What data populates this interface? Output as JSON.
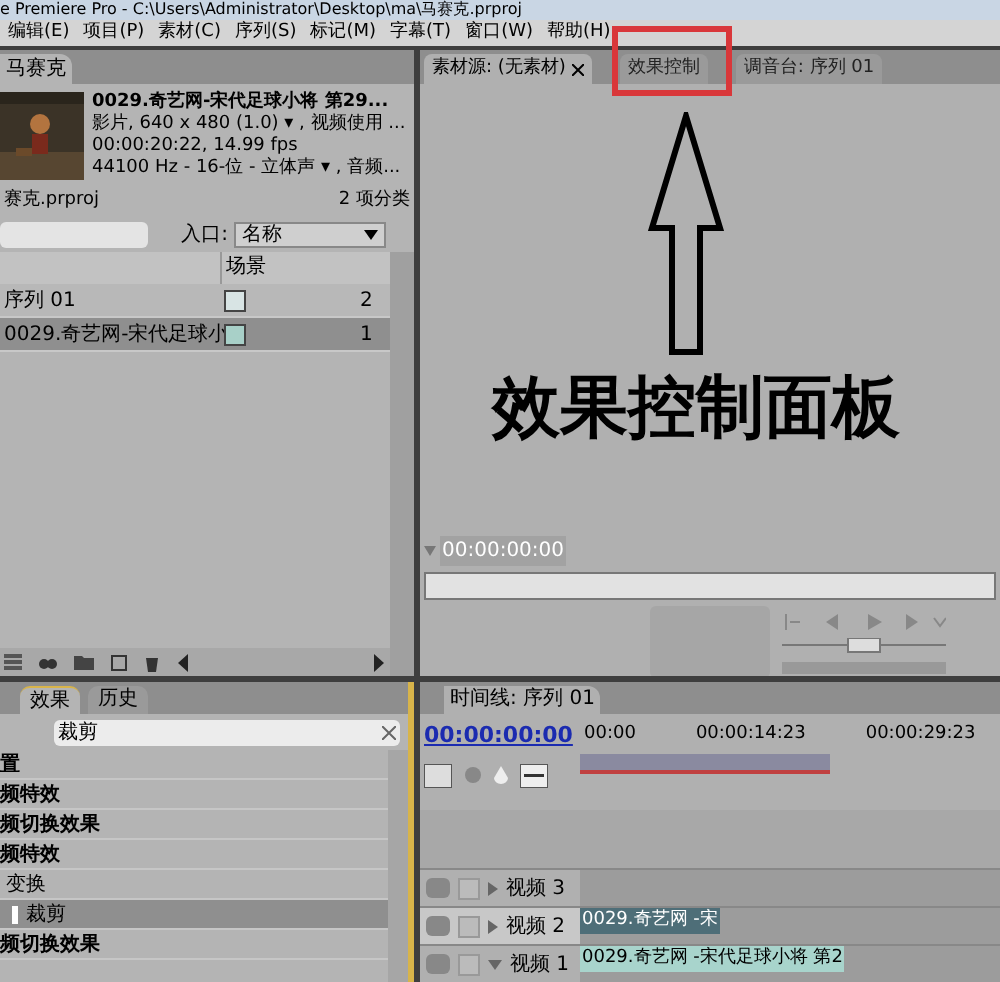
{
  "window": {
    "title": "e Premiere Pro - C:\\Users\\Administrator\\Desktop\\ma\\马赛克.prproj"
  },
  "menu": [
    "编辑(E)",
    "项目(P)",
    "素材(C)",
    "序列(S)",
    "标记(M)",
    "字幕(T)",
    "窗口(W)",
    "帮助(H)"
  ],
  "project_panel": {
    "tab": "马赛克",
    "clip_name": "0029.奇艺网-宋代足球小将 第29...",
    "clip_info": [
      "影片, 640 x 480 (1.0) ▾ , 视频使用 ...",
      "00:00:20:22, 14.99 fps",
      "44100 Hz - 16-位 - 立体声 ▾ , 音频..."
    ],
    "file": "赛克.prproj",
    "count": "2 项分类",
    "entry_label": "入口:",
    "entry_value": "名称",
    "column": "场景",
    "rows": [
      {
        "name": "序列 01",
        "column_3": "2",
        "selected": false
      },
      {
        "name": "0029.奇艺网-宋代足球小",
        "column_3": "1",
        "selected": true
      }
    ]
  },
  "monitor_panel": {
    "tabs": [
      {
        "label": "素材源: (无素材)",
        "selected": true
      },
      {
        "label": "效果控制",
        "selected": false
      },
      {
        "label": "调音台: 序列 01",
        "selected": false
      }
    ],
    "timecode": "00:00:00:00"
  },
  "annotation": {
    "caption": "效果控制面板"
  },
  "effects_panel": {
    "tabs": [
      {
        "label": "效果",
        "selected": true
      },
      {
        "label": "历史",
        "selected": false
      }
    ],
    "search": "裁剪",
    "items": [
      {
        "label": "置",
        "selected": false
      },
      {
        "label": "频特效",
        "selected": false
      },
      {
        "label": "频切换效果",
        "selected": false
      },
      {
        "label": "频特效",
        "selected": false,
        "children": [
          {
            "label": "变换",
            "selected": false,
            "children": [
              {
                "label": "裁剪",
                "selected": true
              }
            ]
          }
        ]
      },
      {
        "label": "频切换效果",
        "selected": false
      }
    ]
  },
  "timeline_panel": {
    "tab": "时间线: 序列 01",
    "timecode": "00:00:00:00",
    "ruler": [
      "00:00",
      "00:00:14:23",
      "00:00:29:23"
    ],
    "tracks": [
      {
        "name": "视频 3",
        "expanded": false
      },
      {
        "name": "视频 2",
        "expanded": false,
        "clip": "0029.奇艺网 -宋"
      },
      {
        "name": "视频 1",
        "expanded": true,
        "clip": "0029.奇艺网 -宋代足球小将 第2"
      }
    ]
  }
}
